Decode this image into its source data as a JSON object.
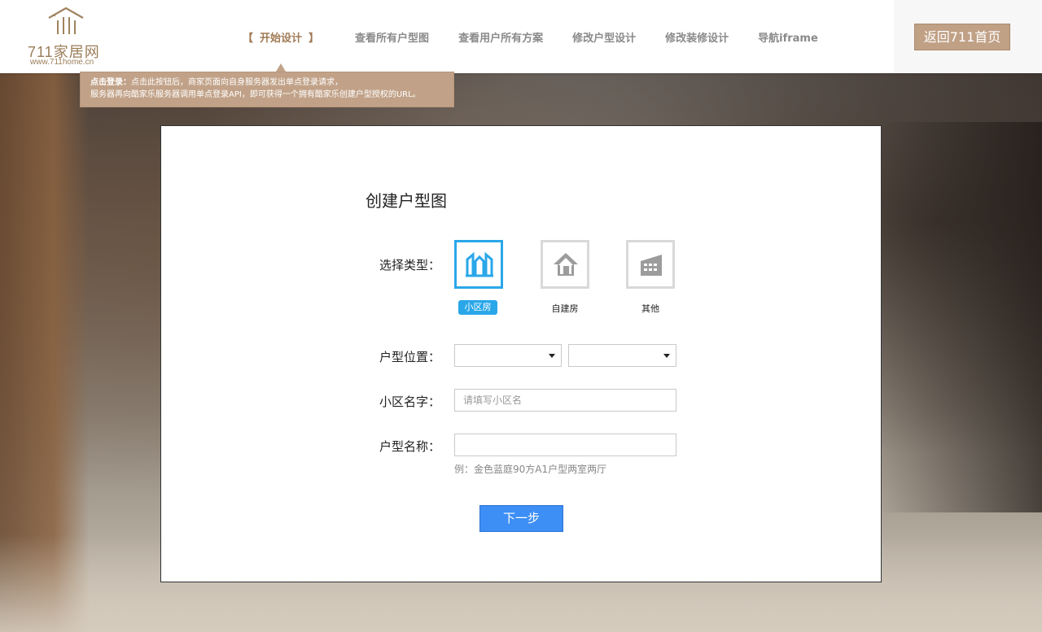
{
  "header": {
    "logo_text": "711家居网",
    "logo_url": "www.711home.cn",
    "nav": [
      {
        "label": "开始设计",
        "active": true,
        "open_bracket": "【",
        "close_bracket": "】"
      },
      {
        "label": "查看所有户型图",
        "active": false
      },
      {
        "label": "查看用户所有方案",
        "active": false
      },
      {
        "label": "修改户型设计",
        "active": false
      },
      {
        "label": "修改装修设计",
        "active": false
      },
      {
        "label": "导航iframe",
        "active": false
      }
    ],
    "back_button": "返回711首页"
  },
  "tooltip": {
    "line1_bold": "点击登录：",
    "line1_rest": "点击此按钮后，商家页面向自身服务器发出单点登录请求，",
    "line2": "服务器再向酷家乐服务器调用单点登录API，即可获得一个拥有酷家乐创建户型授权的URL。"
  },
  "modal": {
    "title": "创建户型图",
    "type_label": "选择类型：",
    "types": [
      {
        "label": "小区房",
        "icon": "apartment-icon",
        "selected": true
      },
      {
        "label": "自建房",
        "icon": "house-icon",
        "selected": false
      },
      {
        "label": "其他",
        "icon": "building-icon",
        "selected": false
      }
    ],
    "location_label": "户型位置：",
    "location_selects": [
      "",
      ""
    ],
    "community_label": "小区名字：",
    "community_placeholder": "请填写小区名",
    "community_value": "",
    "floorplan_label": "户型名称：",
    "floorplan_value": "",
    "floorplan_hint": "例：金色蓝庭90方A1户型两室两厅",
    "next_button": "下一步"
  },
  "colors": {
    "brand": "#a07a55",
    "selected": "#2aa7e9",
    "primary_button": "#3d8ef5",
    "back_button": "#c0a186"
  }
}
